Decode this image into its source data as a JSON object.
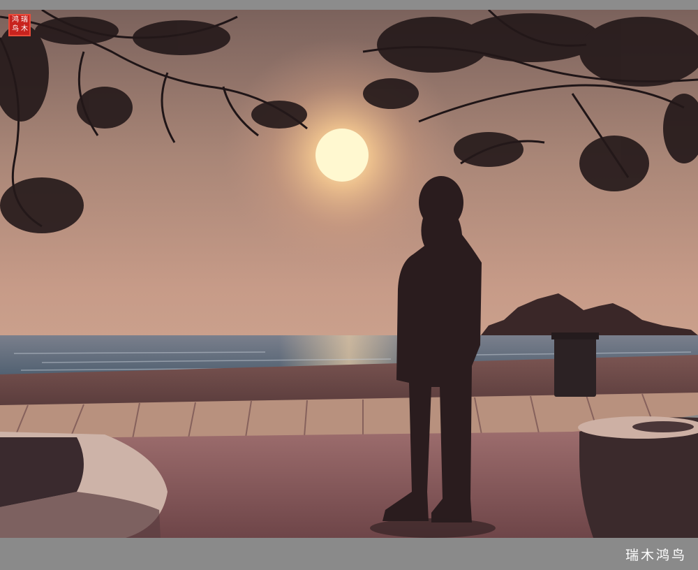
{
  "photo": {
    "description_alt": "",
    "watermark": {
      "text": "瑞木鸿鸟"
    },
    "seal": {
      "chars": [
        "瑞",
        "木",
        "鸿",
        "鸟"
      ]
    },
    "colors": {
      "sky_top": "#6f5a55",
      "sky_mid": "#b08a7a",
      "horizon": "#d8a58e",
      "sun": "#fff4c8",
      "sea": "#5d6f7e",
      "sand": "#6a4a48",
      "boardwalk": "#b99580",
      "plaza": "#9a6e6c",
      "silhouette": "#2a1c1d"
    }
  }
}
